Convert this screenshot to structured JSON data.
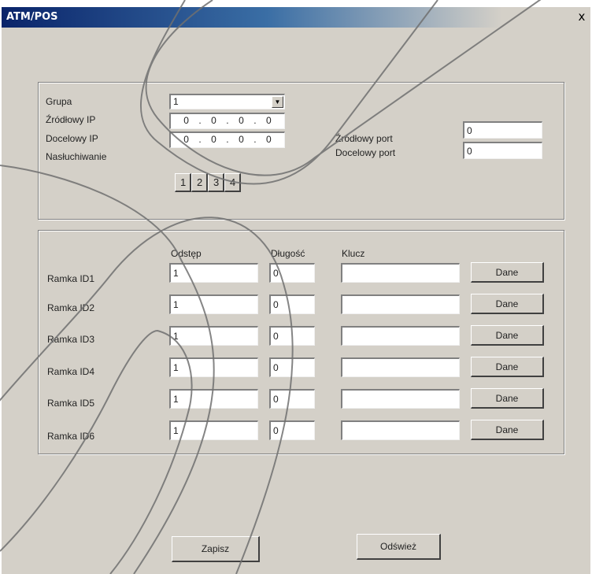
{
  "window": {
    "title": "ATM/POS",
    "close_glyph": "x"
  },
  "network": {
    "group_label": "Grupa",
    "group_value": "1",
    "source_ip_label": "Źródłowy IP",
    "source_ip": [
      "0",
      "0",
      "0",
      "0"
    ],
    "dest_ip_label": "Docelowy IP",
    "dest_ip": [
      "0",
      "0",
      "0",
      "0"
    ],
    "listening_label": "Nasłuchiwanie",
    "listening_buttons": [
      "1",
      "2",
      "3",
      "4"
    ],
    "source_port_label": "Źródłowy port",
    "source_port": "0",
    "dest_port_label": "Docelowy port",
    "dest_port": "0"
  },
  "frames": {
    "col_offset": "Odstęp",
    "col_length": "Długość",
    "col_key": "Klucz",
    "rows": [
      {
        "label": "Ramka ID1",
        "offset": "1",
        "length": "0",
        "key": "",
        "button": "Dane"
      },
      {
        "label": "Ramka ID2",
        "offset": "1",
        "length": "0",
        "key": "",
        "button": "Dane"
      },
      {
        "label": "Ramka ID3",
        "offset": "1",
        "length": "0",
        "key": "",
        "button": "Dane"
      },
      {
        "label": "Ramka ID4",
        "offset": "1",
        "length": "0",
        "key": "",
        "button": "Dane"
      },
      {
        "label": "Ramka ID5",
        "offset": "1",
        "length": "0",
        "key": "",
        "button": "Dane"
      },
      {
        "label": "Ramka ID6",
        "offset": "1",
        "length": "0",
        "key": "",
        "button": "Dane"
      }
    ]
  },
  "footer": {
    "save_label": "Zapisz",
    "refresh_label": "Odśwież"
  },
  "icons": {
    "dropdown": "triangle-down-icon",
    "close": "close-icon"
  }
}
